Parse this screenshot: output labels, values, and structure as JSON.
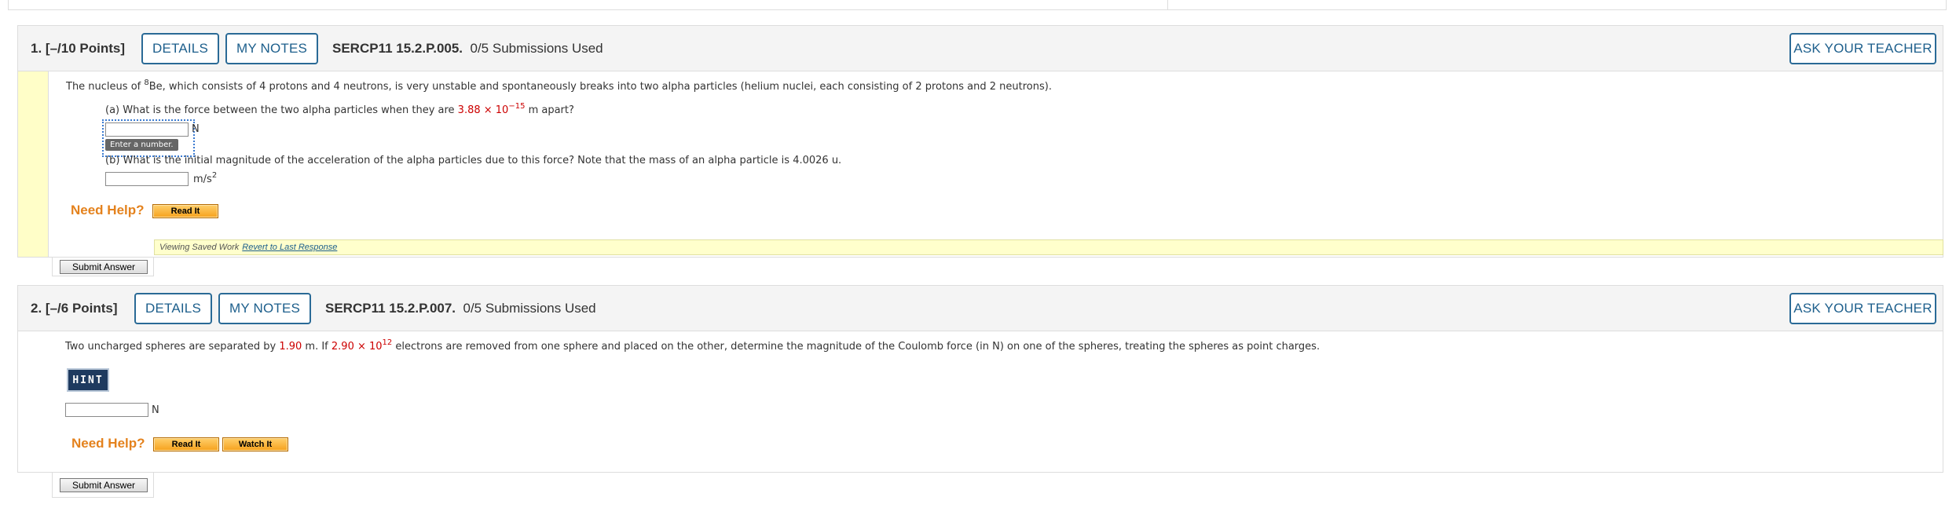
{
  "questions": [
    {
      "number": "1.",
      "points": "[–/10 Points]",
      "details_label": "DETAILS",
      "notes_label": "MY NOTES",
      "code": "SERCP11 15.2.P.005.",
      "submissions": "0/5 Submissions Used",
      "ask_label": "ASK YOUR TEACHER",
      "stem_pre": "The nucleus of ",
      "stem_sup": "8",
      "stem_post": "Be, which consists of 4 protons and 4 neutrons, is very unstable and spontaneously breaks into two alpha particles (helium nuclei, each consisting of 2 protons and 2 neutrons).",
      "part_a_pre": "(a) What is the force between the two alpha particles when they are ",
      "part_a_value": "3.88 × 10",
      "part_a_exp": "−15",
      "part_a_post": " m apart?",
      "part_a_unit": "N",
      "part_a_answer": "",
      "tooltip": "Enter a number.",
      "part_b": "(b) What is the initial magnitude of the acceleration of the alpha particles due to this force? Note that the mass of an alpha particle is 4.0026 u.",
      "part_b_unit": "m/s",
      "part_b_unit_exp": "2",
      "part_b_answer": "",
      "need_help": "Need Help?",
      "read_it": "Read It",
      "submit": "Submit Answer",
      "saved_text": "Viewing Saved Work",
      "revert_link": "Revert to Last Response"
    },
    {
      "number": "2.",
      "points": "[–/6 Points]",
      "details_label": "DETAILS",
      "notes_label": "MY NOTES",
      "code": "SERCP11 15.2.P.007.",
      "submissions": "0/5 Submissions Used",
      "ask_label": "ASK YOUR TEACHER",
      "stem_pre": "Two uncharged spheres are separated by ",
      "stem_v1": "1.90",
      "stem_mid": " m. If ",
      "stem_v2": "2.90 × 10",
      "stem_v2_exp": "12",
      "stem_post": " electrons are removed from one sphere and placed on the other, determine the magnitude of the Coulomb force (in N) on one of the spheres, treating the spheres as point charges.",
      "hint": "HINT",
      "unit": "N",
      "answer": "",
      "need_help": "Need Help?",
      "read_it": "Read It",
      "watch_it": "Watch It",
      "submit": "Submit Answer"
    }
  ]
}
